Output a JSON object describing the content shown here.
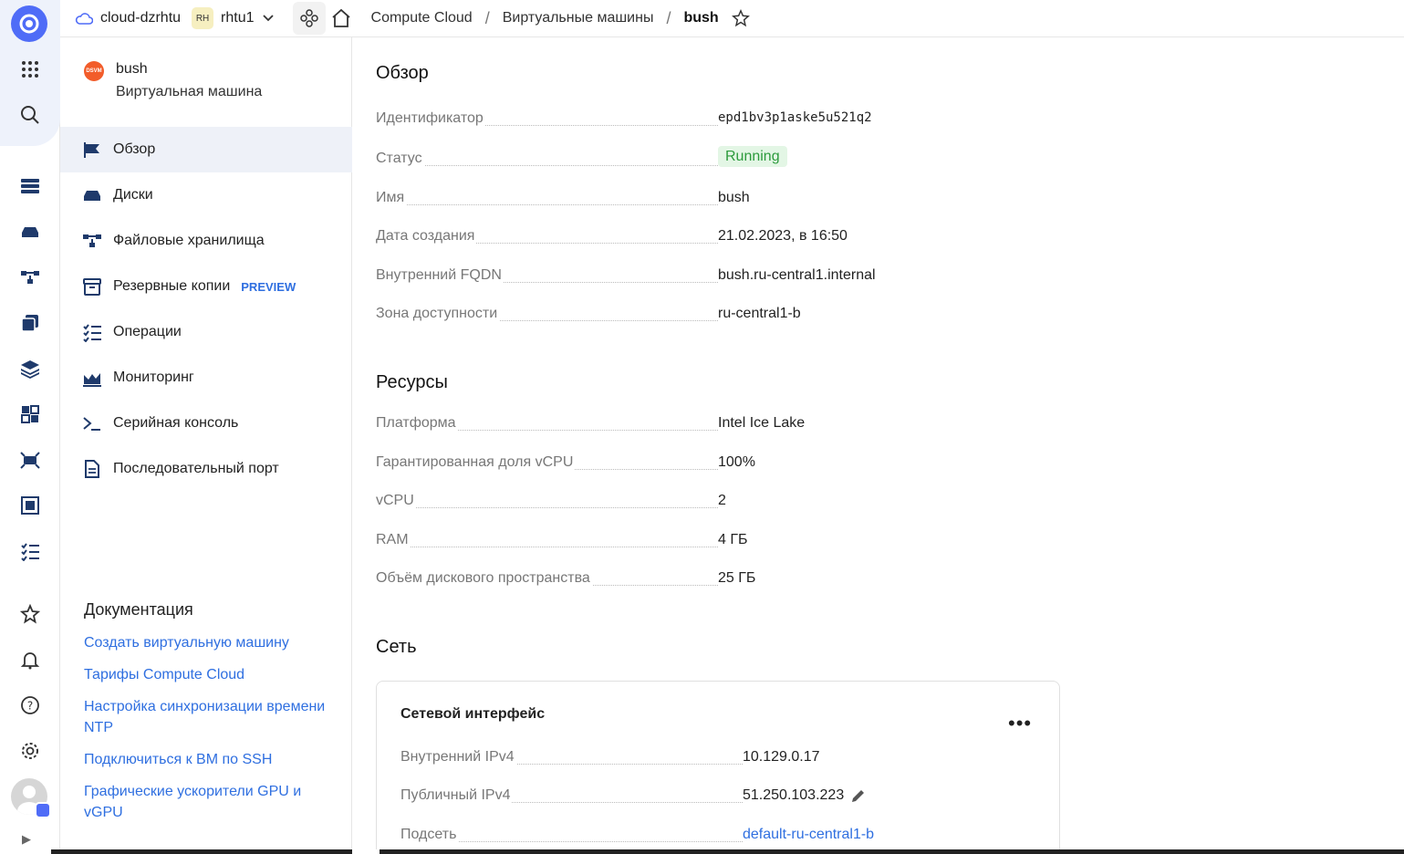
{
  "topbar": {
    "cloud": "cloud-dzrhtu",
    "folder_badge": "RH",
    "folder": "rhtu1",
    "breadcrumb": [
      "Compute Cloud",
      "Виртуальные машины",
      "bush"
    ]
  },
  "vm": {
    "icon_text": "DSVM",
    "name": "bush",
    "type": "Виртуальная машина"
  },
  "nav": [
    {
      "label": "Обзор",
      "icon": "flag-icon"
    },
    {
      "label": "Диски",
      "icon": "disk-icon"
    },
    {
      "label": "Файловые хранилища",
      "icon": "filestore-icon"
    },
    {
      "label": "Резервные копии",
      "icon": "archive-icon",
      "badge": "PREVIEW"
    },
    {
      "label": "Операции",
      "icon": "checklist-icon"
    },
    {
      "label": "Мониторинг",
      "icon": "chart-icon"
    },
    {
      "label": "Серийная консоль",
      "icon": "terminal-icon"
    },
    {
      "label": "Последовательный порт",
      "icon": "document-icon"
    }
  ],
  "docs": {
    "title": "Документация",
    "links": [
      "Создать виртуальную машину",
      "Тарифы Compute Cloud",
      "Настройка синхронизации времени NTP",
      "Подключиться к ВМ по SSH",
      "Графические ускорители GPU и vGPU"
    ]
  },
  "overview": {
    "title": "Обзор",
    "rows": [
      {
        "label": "Идентификатор",
        "value": "epd1bv3p1aske5u521q2"
      },
      {
        "label": "Статус",
        "value": "Running"
      },
      {
        "label": "Имя",
        "value": "bush"
      },
      {
        "label": "Дата создания",
        "value": "21.02.2023, в 16:50"
      },
      {
        "label": "Внутренний FQDN",
        "value": "bush.ru-central1.internal"
      },
      {
        "label": "Зона доступности",
        "value": "ru-central1-b"
      }
    ]
  },
  "resources": {
    "title": "Ресурсы",
    "rows": [
      {
        "label": "Платформа",
        "value": "Intel Ice Lake"
      },
      {
        "label": "Гарантированная доля vCPU",
        "value": "100%"
      },
      {
        "label": "vCPU",
        "value": "2"
      },
      {
        "label": "RAM",
        "value": "4 ГБ"
      },
      {
        "label": "Объём дискового пространства",
        "value": "25 ГБ"
      }
    ]
  },
  "network": {
    "title": "Сеть",
    "card_title": "Сетевой интерфейс",
    "menu": "•••",
    "rows": [
      {
        "label": "Внутренний IPv4",
        "value": "10.129.0.17"
      },
      {
        "label": "Публичный IPv4",
        "value": "51.250.103.223"
      },
      {
        "label": "Подсеть",
        "value": "default-ru-central1-b"
      }
    ]
  },
  "colors": {
    "accent": "#2f6fe0",
    "status_bg": "#e3f6e5",
    "status_text": "#2c9b3c",
    "logo": "#4f6cf7"
  }
}
